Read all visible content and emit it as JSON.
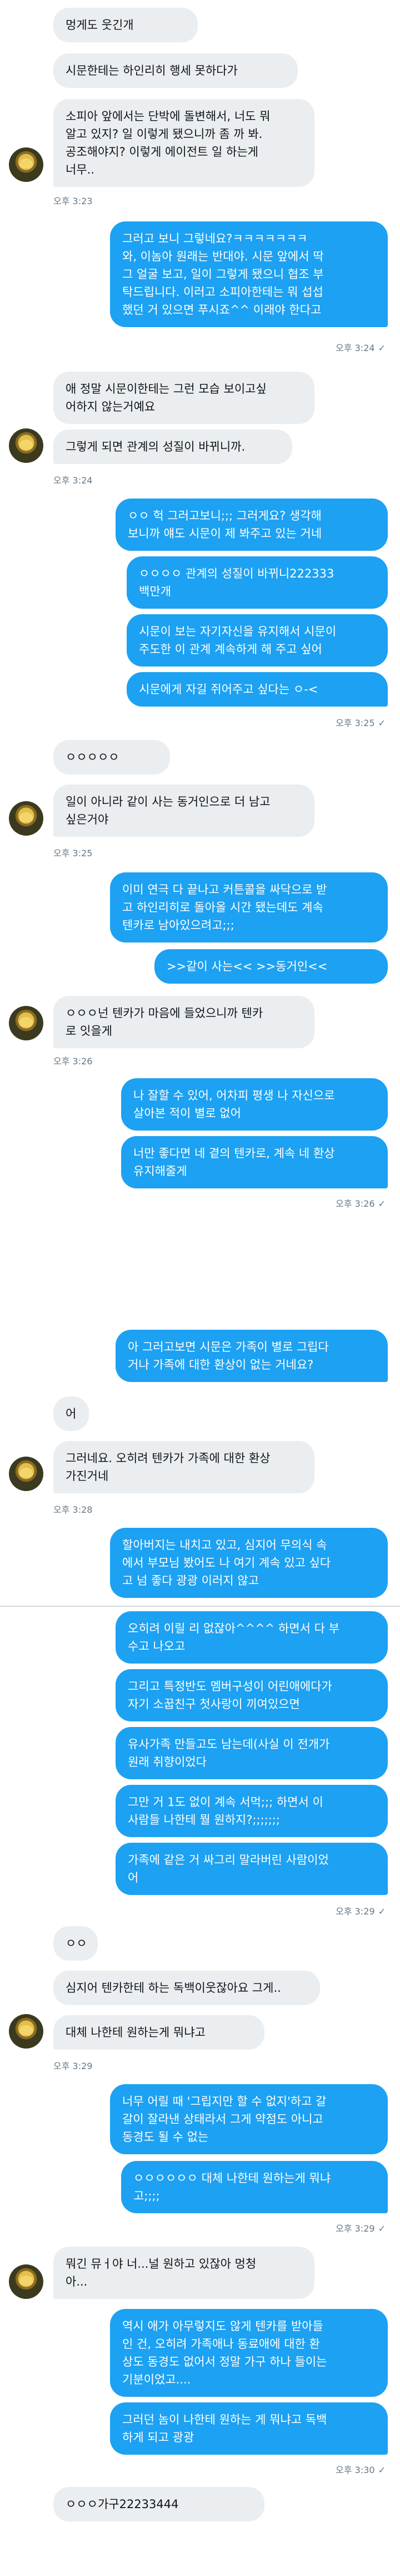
{
  "messages": [
    {
      "id": "m1",
      "side": "in",
      "lines": [
        "멍게도 웃긴개"
      ]
    },
    {
      "id": "m2",
      "side": "in",
      "lines": [
        "시문한테는 하인리히 행세 못하다가"
      ]
    },
    {
      "id": "m3",
      "side": "in",
      "lines": [
        "소피아 앞에서는 단박에 돌변해서, 너도 뭐",
        "알고 있지? 일 이렇게 됐으니까 좀 까 봐.",
        "공조해야지? 이렇게 에이전트 일 하는게",
        "너무.."
      ]
    },
    {
      "id": "t1",
      "type": "time",
      "side": "in",
      "text": "오후 3:23"
    },
    {
      "id": "m4",
      "side": "out",
      "lines": [
        "그러고 보니 그렇네요?ㅋㅋㅋㅋㅋㅋㅋ",
        "와, 이놈아 원래는 반대야. 시문 앞에서 딱",
        "그 얼굴 보고, 일이 그렇게 됐으니 협조 부",
        "탁드립니다. 이러고 소피아한테는 뭐 섭섭",
        "했던 거 있으면 푸시죠^^ 이래야 한다고"
      ]
    },
    {
      "id": "t2",
      "type": "time",
      "side": "out",
      "text": "오후 3:24"
    },
    {
      "id": "m5",
      "side": "in",
      "lines": [
        "애 정말 시문이한테는 그런 모습 보이고싶",
        "어하지 않는거예요"
      ]
    },
    {
      "id": "m6",
      "side": "in",
      "lines": [
        "그렇게 되면 관계의 성질이 바뀌니까."
      ]
    },
    {
      "id": "t3",
      "type": "time",
      "side": "in",
      "text": "오후 3:24"
    },
    {
      "id": "m7",
      "side": "out",
      "lines": [
        "ㅇㅇ 헉 그러고보니;;; 그러게요? 생각해",
        "보니까 얘도 시문이 제 봐주고 있는 거네"
      ]
    },
    {
      "id": "m8",
      "side": "out",
      "lines": [
        "ㅇㅇㅇㅇ 관계의 성질이 바뀌니222333",
        "백만개"
      ]
    },
    {
      "id": "m9",
      "side": "out",
      "lines": [
        "시문이 보는 자기자신을 유지해서 시문이",
        "주도한 이 관계 계속하게 해 주고 싶어"
      ]
    },
    {
      "id": "m10",
      "side": "out",
      "lines": [
        "시문에게 자길 쥐어주고 싶다는 ㅇ-<"
      ]
    },
    {
      "id": "t4",
      "type": "time",
      "side": "out",
      "text": "오후 3:25"
    },
    {
      "id": "m11",
      "side": "in",
      "lines": [
        "ㅇㅇㅇㅇㅇ"
      ]
    },
    {
      "id": "m12",
      "side": "in",
      "lines": [
        "일이 아니라 같이 사는 동거인으로 더 남고",
        "싶은거야"
      ]
    },
    {
      "id": "t5",
      "type": "time",
      "side": "in",
      "text": "오후 3:25"
    },
    {
      "id": "m13",
      "side": "out",
      "lines": [
        "이미 연극 다 끝나고 커튼콜을 싸닥으로 받",
        "고 하인리히로 돌아올 시간 됐는데도 계속",
        "텐카로 남아있으려고;;;"
      ]
    },
    {
      "id": "m14",
      "side": "out",
      "lines": [
        ">>같이 사는<< >>동거인<<"
      ]
    },
    {
      "id": "m15",
      "side": "in",
      "lines": [
        "ㅇㅇㅇ넌 텐카가 마음에 들었으니까 텐카",
        "로 잇을게"
      ]
    },
    {
      "id": "t6",
      "type": "time",
      "side": "in",
      "text": "오후 3:26"
    },
    {
      "id": "m16",
      "side": "out",
      "lines": [
        "나 잘할 수 있어, 어차피 평생 나 자신으로",
        "살아본 적이 별로 없어"
      ]
    },
    {
      "id": "m17",
      "side": "out",
      "lines": [
        "너만 좋다면 네 곁의 텐카로, 계속 네 환상",
        "유지해줄게"
      ]
    },
    {
      "id": "t7",
      "type": "time",
      "side": "out",
      "text": "오후 3:26"
    },
    {
      "id": "m18",
      "side": "out",
      "lines": [
        "아 그러고보면 시문은 가족이 별로 그립다",
        "거나 가족에 대한 환상이 없는 거네요?"
      ]
    },
    {
      "id": "m19",
      "side": "in",
      "lines": [
        "어"
      ]
    },
    {
      "id": "m20",
      "side": "in",
      "lines": [
        "그러네요. 오히려 텐카가 가족에 대한 환상",
        "가진거네"
      ]
    },
    {
      "id": "t8",
      "type": "time",
      "side": "in",
      "text": "오후 3:28"
    },
    {
      "id": "m21",
      "side": "out",
      "lines": [
        "할아버지는 내치고 있고, 심지어 무의식 속",
        "에서 부모님 봤어도 나 여기 계속 있고 싶다",
        "고 넘 좋다 광광 이러지 않고"
      ]
    },
    {
      "id": "m22",
      "side": "out",
      "lines": [
        "오히려 이릴 리 없잖아^^^^ 하면서 다 부",
        "수고 나오고"
      ]
    },
    {
      "id": "m23",
      "side": "out",
      "lines": [
        "그리고 특정반도 멤버구성이 어린애에다가",
        "자기 소꿉친구 첫사랑이 끼여있으면"
      ]
    },
    {
      "id": "m24",
      "side": "out",
      "lines": [
        "유사가족 만들고도 남는데(사실 이 전개가",
        "원래 취향이었다"
      ]
    },
    {
      "id": "m25",
      "side": "out",
      "lines": [
        "그만 거 1도 없이 계속 서먹;;; 하면서 이",
        "사람들 나한테 뭘 원하지?;;;;;;;"
      ]
    },
    {
      "id": "m26",
      "side": "out",
      "lines": [
        "가족에 같은 거 싸그리 말라버린 사람이었",
        "어"
      ]
    },
    {
      "id": "t9",
      "type": "time",
      "side": "out",
      "text": "오후 3:29"
    },
    {
      "id": "m27",
      "side": "in",
      "lines": [
        "ㅇㅇ"
      ]
    },
    {
      "id": "m28",
      "side": "in",
      "lines": [
        "심지어 텐카한테 하는 독백이웃잖아요 그게.."
      ]
    },
    {
      "id": "m29",
      "side": "in",
      "lines": [
        "대체 나한테 원하는게 뭐냐고"
      ]
    },
    {
      "id": "t10",
      "type": "time",
      "side": "in",
      "text": "오후 3:29"
    },
    {
      "id": "m30",
      "side": "out",
      "lines": [
        "너무 어릴 때 '그립지만 할 수 없지'하고 갈",
        "갈이 잘라낸 상태라서 그게 약점도 아니고",
        "동경도 될 수 없는"
      ]
    },
    {
      "id": "m31",
      "side": "out",
      "lines": [
        "ㅇㅇㅇㅇㅇㅇ 대체 나한테 원하는게 뭐냐",
        "고;;;;"
      ]
    },
    {
      "id": "t11",
      "type": "time",
      "side": "out",
      "text": "오후 3:29"
    },
    {
      "id": "m32",
      "side": "in",
      "lines": [
        "뭐긴 뮤ㅓ야 너...널 원하고 있잖아 멍청",
        "아..."
      ]
    },
    {
      "id": "m33",
      "side": "out",
      "lines": [
        "역시 애가 아무렇지도 않게 텐카를 받아들",
        "인 건, 오히려 가족애나 동료애에 대한 환",
        "상도 동경도 없어서 정말 가구 하나 들이는",
        "기분이었고...."
      ]
    },
    {
      "id": "m34",
      "side": "out",
      "lines": [
        "그러던 놈이 나한테 원하는 게 뭐냐고 독백",
        "하게 되고 광광"
      ]
    },
    {
      "id": "t12",
      "type": "time",
      "side": "out",
      "text": "오후 3:30"
    },
    {
      "id": "m35",
      "side": "in",
      "lines": [
        "ㅇㅇㅇ가구22233444"
      ]
    }
  ]
}
